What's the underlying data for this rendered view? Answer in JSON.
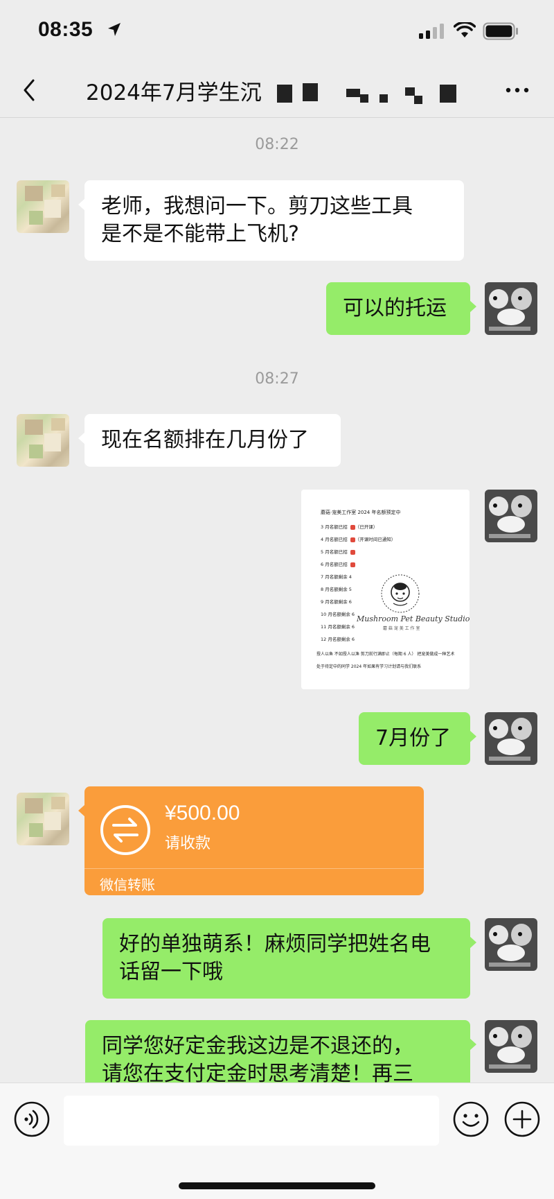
{
  "status_bar": {
    "time": "08:35"
  },
  "nav": {
    "title": "2024年7月学生沉",
    "back_icon": "chevron-left-icon",
    "more_icon": "more-icon"
  },
  "timestamps": [
    "08:22",
    "08:27"
  ],
  "messages": [
    {
      "side": "left",
      "text_lines": [
        "老师，我想问一下。剪刀这些工具",
        "是不是不能带上飞机?"
      ]
    },
    {
      "side": "right",
      "text": "可以的托运"
    },
    {
      "side": "left",
      "text": "现在名额排在几月份了"
    },
    {
      "side": "right",
      "type": "image",
      "image": {
        "heading": "蘑菇·宠美工作室 2024 年名额预定中",
        "rows": [
          {
            "label": "3 月名额已招",
            "mark": true,
            "note": "（已开课）"
          },
          {
            "label": "4 月名额已招",
            "mark": true,
            "note": "（开课时间已通知）"
          },
          {
            "label": "5 月名额已招",
            "mark": true,
            "note": ""
          },
          {
            "label": "6 月名额已招",
            "mark": true,
            "note": ""
          },
          {
            "label": "7 月名额剩余 4",
            "mark": false,
            "note": ""
          },
          {
            "label": "8 月名额剩余 5",
            "mark": false,
            "note": ""
          },
          {
            "label": "9 月名额剩余 6",
            "mark": false,
            "note": ""
          },
          {
            "label": "10 月名额剩余 6",
            "mark": false,
            "note": ""
          },
          {
            "label": "11 月名额剩余 6",
            "mark": false,
            "note": ""
          },
          {
            "label": "12 月名额剩余 6",
            "mark": false,
            "note": ""
          }
        ],
        "footer_lines": [
          "授人以鱼 不如授人以渔 剪刀前行满即止（每期 6 人）   把宠美做成一种艺术",
          "处于待定中的同学 2024 年如果有学习计划请与我们联系"
        ],
        "brand": "Mushroom Pet Beauty Studio",
        "brand_cn": "蘑 菇 宠 美 工 作 室"
      }
    },
    {
      "side": "right",
      "text": "7月份了"
    },
    {
      "side": "left",
      "type": "transfer",
      "amount": "¥500.00",
      "status": "请收款",
      "label": "微信转账",
      "color": "#fa9d3b"
    },
    {
      "side": "right",
      "text_lines": [
        "好的单独萌系！麻烦同学把姓名电",
        "话留一下哦"
      ]
    },
    {
      "side": "right",
      "text_lines": [
        "同学您好定金我这边是不退还的，",
        "请您在支付定金时思考清楚！再三"
      ]
    }
  ],
  "input_bar": {
    "voice_icon": "voice-icon",
    "emoji_icon": "emoji-icon",
    "plus_icon": "plus-icon"
  },
  "colors": {
    "sent_bubble": "#95ec69",
    "received_bubble": "#ffffff",
    "background": "#ededed",
    "transfer": "#fa9d3b"
  }
}
